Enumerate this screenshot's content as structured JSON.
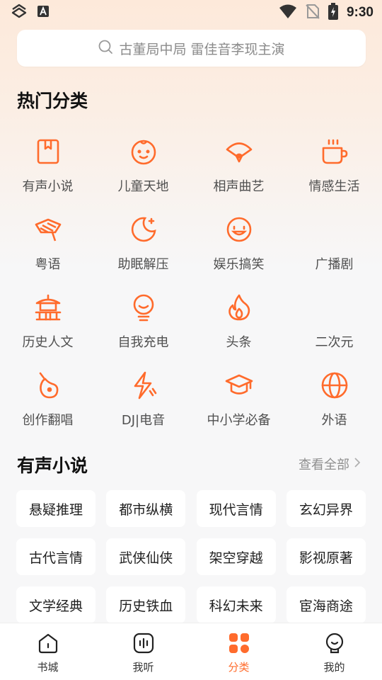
{
  "status_bar": {
    "time": "9:30"
  },
  "search": {
    "placeholder": "古董局中局 雷佳音李现主演"
  },
  "hot_categories": {
    "title": "热门分类",
    "items": [
      {
        "label": "有声小说",
        "icon": "book-icon"
      },
      {
        "label": "儿童天地",
        "icon": "baby-face-icon"
      },
      {
        "label": "相声曲艺",
        "icon": "fan-icon"
      },
      {
        "label": "情感生活",
        "icon": "coffee-cup-icon"
      },
      {
        "label": "粤语",
        "icon": "crab-hat-icon"
      },
      {
        "label": "助眠解压",
        "icon": "moon-icon"
      },
      {
        "label": "娱乐搞笑",
        "icon": "smile-icon"
      },
      {
        "label": "广播剧",
        "icon": ""
      },
      {
        "label": "历史人文",
        "icon": "pagoda-icon"
      },
      {
        "label": "自我充电",
        "icon": "lightbulb-icon"
      },
      {
        "label": "头条",
        "icon": "flame-icon"
      },
      {
        "label": "二次元",
        "icon": ""
      },
      {
        "label": "创作翻唱",
        "icon": "guitar-icon"
      },
      {
        "label": "DJ|电音",
        "icon": "lightning-icon"
      },
      {
        "label": "中小学必备",
        "icon": "graduation-cap-icon"
      },
      {
        "label": "外语",
        "icon": "globe-icon"
      }
    ]
  },
  "audio_novels": {
    "title": "有声小说",
    "more_label": "查看全部",
    "tags": [
      "悬疑推理",
      "都市纵横",
      "现代言情",
      "玄幻异界",
      "古代言情",
      "武侠仙侠",
      "架空穿越",
      "影视原著",
      "文学经典",
      "历史铁血",
      "科幻未来",
      "宦海商途"
    ]
  },
  "bottom_nav": {
    "items": [
      {
        "label": "书城",
        "icon": "house-icon"
      },
      {
        "label": "我听",
        "icon": "audio-wave-icon"
      },
      {
        "label": "分类",
        "icon": "grid-icon"
      },
      {
        "label": "我的",
        "icon": "profile-icon"
      }
    ],
    "active_index": 2
  },
  "colors": {
    "accent": "#ff6b2c",
    "background": "#f7f7f8",
    "header_tint": "#fde9da"
  }
}
